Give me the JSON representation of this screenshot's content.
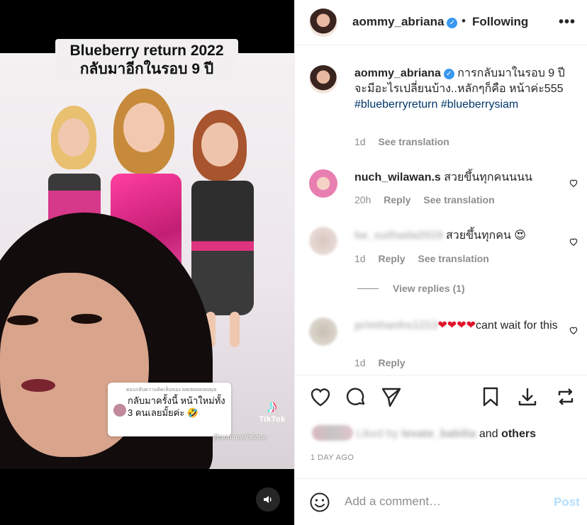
{
  "video": {
    "title_line1": "Blueberry return 2022",
    "title_line2": "กลับมาอีกในรอบ 9 ปี",
    "reply_card_meta": "ตอบกลับความคิดเห็นของ waraswarasaya",
    "reply_card_text": "กลับมาครั้งนี้ หน้าใหม่ทั้ง 3 คนเลยมั้ยค่ะ 🤣",
    "tiktok_logo": "♪",
    "tiktok_label": "TikTok",
    "tiktok_handle": "@aommyabriana"
  },
  "header": {
    "username": "aommy_abriana",
    "separator": "•",
    "follow_status": "Following",
    "more": "•••"
  },
  "caption": {
    "username": "aommy_abriana",
    "text": "การกลับมาในรอบ 9 ปีจะมีอะไรเปลี่ยนบ้าง..หลักๆก็คือ หน้าค่ะ555",
    "hashtag1": "#blueberryreturn",
    "hashtag2": "#blueberrysiam",
    "age": "1d",
    "see_translation": "See translation"
  },
  "comments": [
    {
      "username": "nuch_wilawan.s",
      "text": "สวยขึ้นทุกคนนนน",
      "age": "20h",
      "reply": "Reply",
      "see_translation": "See translation"
    },
    {
      "username": "be_suthada2019",
      "text": "สวยขึ้นทุกคน 😍",
      "age": "1d",
      "reply": "Reply",
      "see_translation": "See translation",
      "view_replies": "View replies (1)"
    },
    {
      "username": "primhanhs1213",
      "hearts": "❤❤❤❤",
      "text": "cant wait for this",
      "age": "1d",
      "reply": "Reply"
    }
  ],
  "likes": {
    "prefix": "Liked by",
    "blurred_user": "levate_babilia",
    "and": "and",
    "others": "others"
  },
  "post_age": "1 DAY AGO",
  "add_comment": {
    "placeholder": "Add a comment…",
    "post_label": "Post"
  },
  "colors": {
    "link": "#00376b",
    "verified": "#3897f0",
    "post_disabled": "#b2dffc",
    "muted": "#8e8e8e"
  },
  "icons": [
    "heart-icon",
    "comment-icon",
    "share-icon",
    "bookmark-icon",
    "download-icon",
    "repost-icon",
    "smile-icon",
    "speaker-icon",
    "verified-icon",
    "more-icon"
  ]
}
